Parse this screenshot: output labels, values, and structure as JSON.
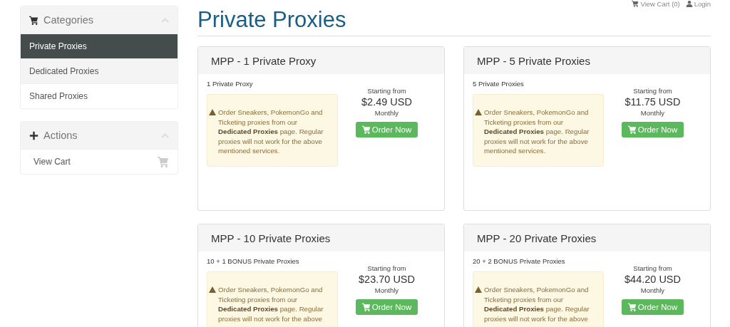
{
  "top_links": [
    {
      "kind": "cart",
      "label": "View Cart (0)"
    },
    {
      "kind": "user",
      "label": "Login"
    }
  ],
  "sidebar": [
    {
      "title": "Categories",
      "kind": "cart",
      "items": [
        {
          "label": "Private Proxies",
          "selected": true
        },
        {
          "label": "Dedicated Proxies",
          "selected": false
        },
        {
          "label": "Shared Proxies",
          "selected": false
        }
      ]
    },
    {
      "title": "Actions",
      "kind": "plus",
      "items": [
        {
          "label": "View Cart",
          "kind": "link",
          "selected": false
        }
      ]
    }
  ],
  "page_title": "Private Proxies",
  "products": [
    {
      "title": "MPP - 1 Private Proxy",
      "description": "1 Private Proxy",
      "note": "Order Sneakers, PokemonGo and Ticketing proxies from our **Dedicated Proxies** page. Regular proxies will not work for the above mentioned services.",
      "price_caption": "Starting from",
      "price": "$2.49 USD",
      "cycle": "Monthly",
      "button": "Order Now"
    },
    {
      "title": "MPP - 5 Private Proxies",
      "description": "5 Private Proxies",
      "note": "Order Sneakers, PokemonGo and Ticketing proxies from our **Dedicated Proxies** page. Regular proxies will not work for the above mentioned services.",
      "price_caption": "Starting from",
      "price": "$11.75 USD",
      "cycle": "Monthly",
      "button": "Order Now"
    },
    {
      "title": "MPP - 10 Private Proxies",
      "description": "10 + 1 BONUS Private Proxies",
      "note": "Order Sneakers, PokemonGo and Ticketing proxies from our **Dedicated Proxies** page. Regular proxies will not work for the above",
      "price_caption": "Starting from",
      "price": "$23.70 USD",
      "cycle": "Monthly",
      "button": "Order Now"
    },
    {
      "title": "MPP - 20 Private Proxies",
      "description": "20 + 2 BONUS Private Proxies",
      "note": "Order Sneakers, PokemonGo and Ticketing proxies from our **Dedicated Proxies** page. Regular proxies will not work for the above",
      "price_caption": "Starting from",
      "price": "$44.20 USD",
      "cycle": "Monthly",
      "button": "Order Now"
    }
  ]
}
